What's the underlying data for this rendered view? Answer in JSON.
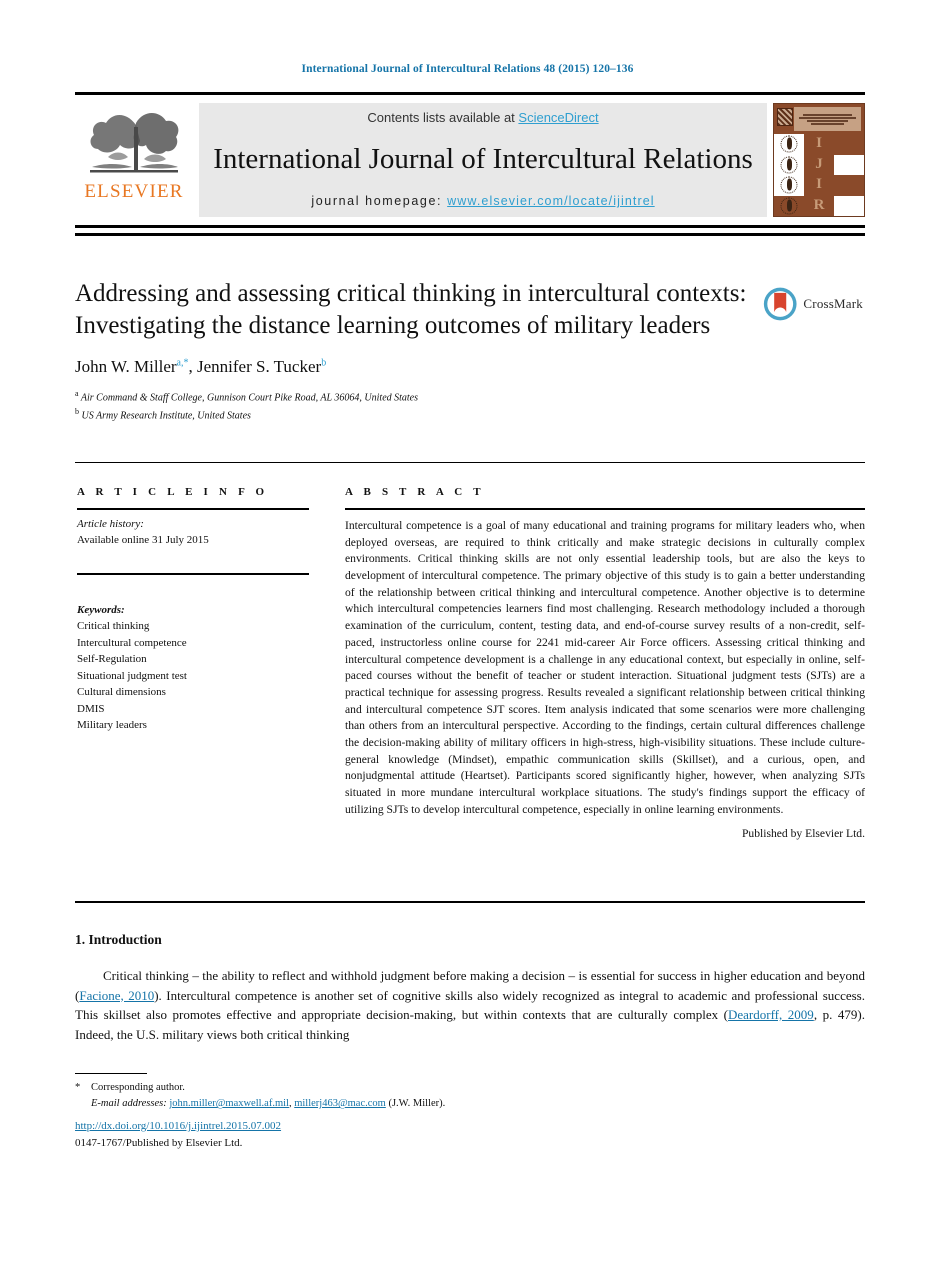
{
  "running_head": "International Journal of Intercultural Relations 48 (2015) 120–136",
  "masthead": {
    "publisher_name": "ELSEVIER",
    "contents_prefix": "Contents lists available at ",
    "sciencedirect": "ScienceDirect",
    "journal_title": "International Journal of Intercultural Relations",
    "homepage_label": "journal homepage:",
    "homepage_url": "www.elsevier.com/locate/ijintrel",
    "cover_letters": [
      "I",
      "J",
      "I",
      "R"
    ]
  },
  "crossmark": {
    "label": "CrossMark"
  },
  "article": {
    "title": "Addressing and assessing critical thinking in intercultural contexts: Investigating the distance learning outcomes of military leaders",
    "authors": [
      {
        "name": "John W. Miller",
        "marks": "a,*"
      },
      {
        "name": "Jennifer S. Tucker",
        "marks": "b"
      }
    ],
    "affiliations": [
      {
        "mark": "a",
        "text": "Air Command & Staff College, Gunnison Court Pike Road, AL 36064, United States"
      },
      {
        "mark": "b",
        "text": "US Army Research Institute, United States"
      }
    ]
  },
  "article_info": {
    "heading": "A R T I C L E   I N F O",
    "history_label": "Article history:",
    "history_value": "Available online 31 July 2015",
    "keywords_label": "Keywords:",
    "keywords": [
      "Critical thinking",
      "Intercultural competence",
      "Self-Regulation",
      "Situational judgment test",
      "Cultural dimensions",
      "DMIS",
      "Military leaders"
    ]
  },
  "abstract": {
    "heading": "A B S T R A C T",
    "text": "Intercultural competence is a goal of many educational and training programs for military leaders who, when deployed overseas, are required to think critically and make strategic decisions in culturally complex environments. Critical thinking skills are not only essential leadership tools, but are also the keys to development of intercultural competence. The primary objective of this study is to gain a better understanding of the relationship between critical thinking and intercultural competence. Another objective is to determine which intercultural competencies learners find most challenging. Research methodology included a thorough examination of the curriculum, content, testing data, and end-of-course survey results of a non-credit, self-paced, instructorless online course for 2241 mid-career Air Force officers. Assessing critical thinking and intercultural competence development is a challenge in any educational context, but especially in online, self-paced courses without the benefit of teacher or student interaction. Situational judgment tests (SJTs) are a practical technique for assessing progress. Results revealed a significant relationship between critical thinking and intercultural competence SJT scores. Item analysis indicated that some scenarios were more challenging than others from an intercultural perspective. According to the findings, certain cultural differences challenge the decision-making ability of military officers in high-stress, high-visibility situations. These include culture-general knowledge (Mindset), empathic communication skills (Skillset), and a curious, open, and nonjudgmental attitude (Heartset). Participants scored significantly higher, however, when analyzing SJTs situated in more mundane intercultural workplace situations. The study's findings support the efficacy of utilizing SJTs to develop intercultural competence, especially in online learning environments.",
    "publisher_statement": "Published by Elsevier Ltd."
  },
  "body": {
    "section_number": "1.",
    "section_title": "Introduction",
    "paragraph_part1": "Critical thinking – the ability to reflect and withhold judgment before making a decision – is essential for success in higher education and beyond (",
    "citation1": "Facione, 2010",
    "paragraph_part2": "). Intercultural competence is another set of cognitive skills also widely recognized as integral to academic and professional success. This skillset also promotes effective and appropriate decision-making, but within contexts that are culturally complex (",
    "citation2": "Deardorff, 2009",
    "paragraph_part3": ", p. 479). Indeed, the U.S. military views both critical thinking"
  },
  "footer": {
    "corresponding_marker": "*",
    "corresponding_label": "Corresponding author.",
    "email_label": "E-mail addresses:",
    "email1": "john.miller@maxwell.af.mil",
    "email_separator": ", ",
    "email2": "millerj463@mac.com",
    "email_attribution": " (J.W. Miller).",
    "doi": "http://dx.doi.org/10.1016/j.ijintrel.2015.07.002",
    "issn_line": "0147-1767/Published by Elsevier Ltd."
  },
  "colors": {
    "link_blue": "#1574a8",
    "sciencedirect_blue": "#2f9fd0",
    "elsevier_orange": "#e87722",
    "cover_brown": "#8a4a2a"
  }
}
